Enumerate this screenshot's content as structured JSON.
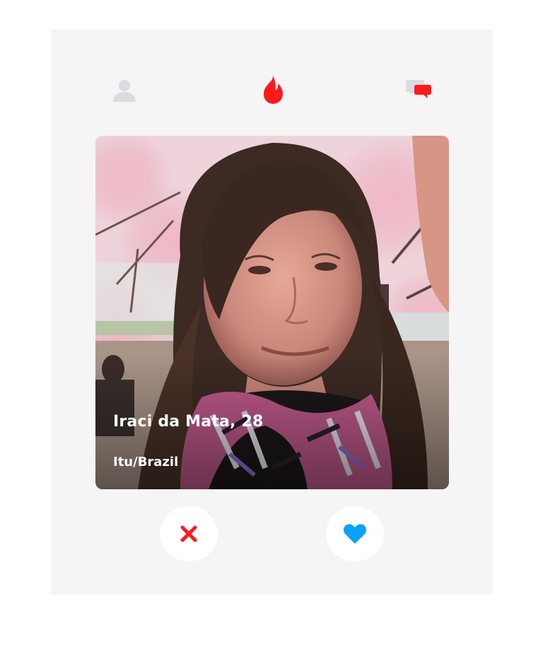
{
  "nav": {
    "profile_icon": "user-icon",
    "home_icon": "flame-icon",
    "messages_icon": "chat-bubbles-icon"
  },
  "profile_card": {
    "name_age": "Iraci da Mata, 28",
    "location": "Itu/Brazil"
  },
  "actions": {
    "dislike_icon": "x-icon",
    "like_icon": "heart-icon"
  },
  "colors": {
    "brand_red": "#ff1a1a",
    "like_blue": "#0aa0ff",
    "panel_bg": "#f5f5f5",
    "muted_icon": "#dcdce0"
  }
}
